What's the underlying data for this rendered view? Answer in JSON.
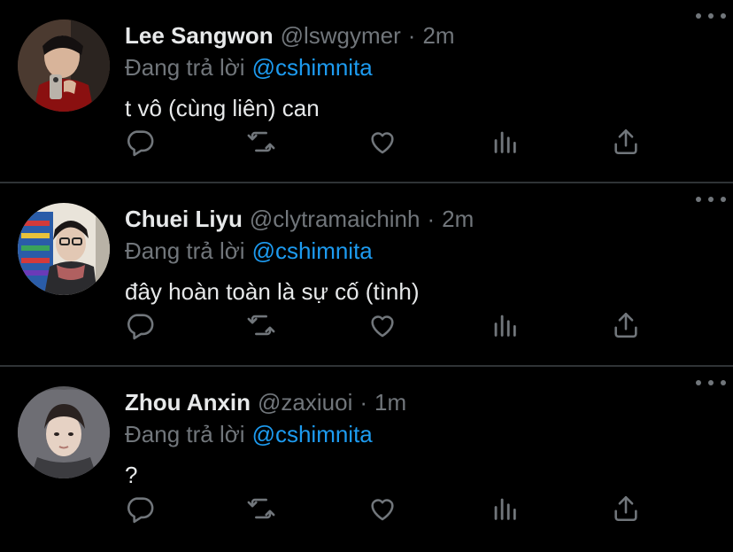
{
  "colors": {
    "background": "#000000",
    "text": "#e7e9ea",
    "muted": "#71767b",
    "mention": "#1d9bf0",
    "divider": "#2f3336"
  },
  "tweets": [
    {
      "name": "Lee Sangwon",
      "handle": "@lswgymer",
      "separator": "·",
      "time": "2m",
      "reply_label": "Đang trả lời",
      "reply_mention": "@cshimnita",
      "text": "t vô (cùng liên) can",
      "icons": [
        "reply-icon",
        "retweet-icon",
        "like-icon",
        "stats-icon",
        "share-icon",
        "more-icon"
      ]
    },
    {
      "name": "Chuei Liyu",
      "handle": "@clytramaichinh",
      "separator": "·",
      "time": "2m",
      "reply_label": "Đang trả lời",
      "reply_mention": "@cshimnita",
      "text": "đây hoàn toàn là sự cố (tình)",
      "icons": [
        "reply-icon",
        "retweet-icon",
        "like-icon",
        "stats-icon",
        "share-icon",
        "more-icon"
      ]
    },
    {
      "name": "Zhou Anxin",
      "handle": "@zaxiuoi",
      "separator": "·",
      "time": "1m",
      "reply_label": "Đang trả lời",
      "reply_mention": "@cshimnita",
      "text": "?",
      "icons": [
        "reply-icon",
        "retweet-icon",
        "like-icon",
        "stats-icon",
        "share-icon",
        "more-icon"
      ]
    }
  ]
}
